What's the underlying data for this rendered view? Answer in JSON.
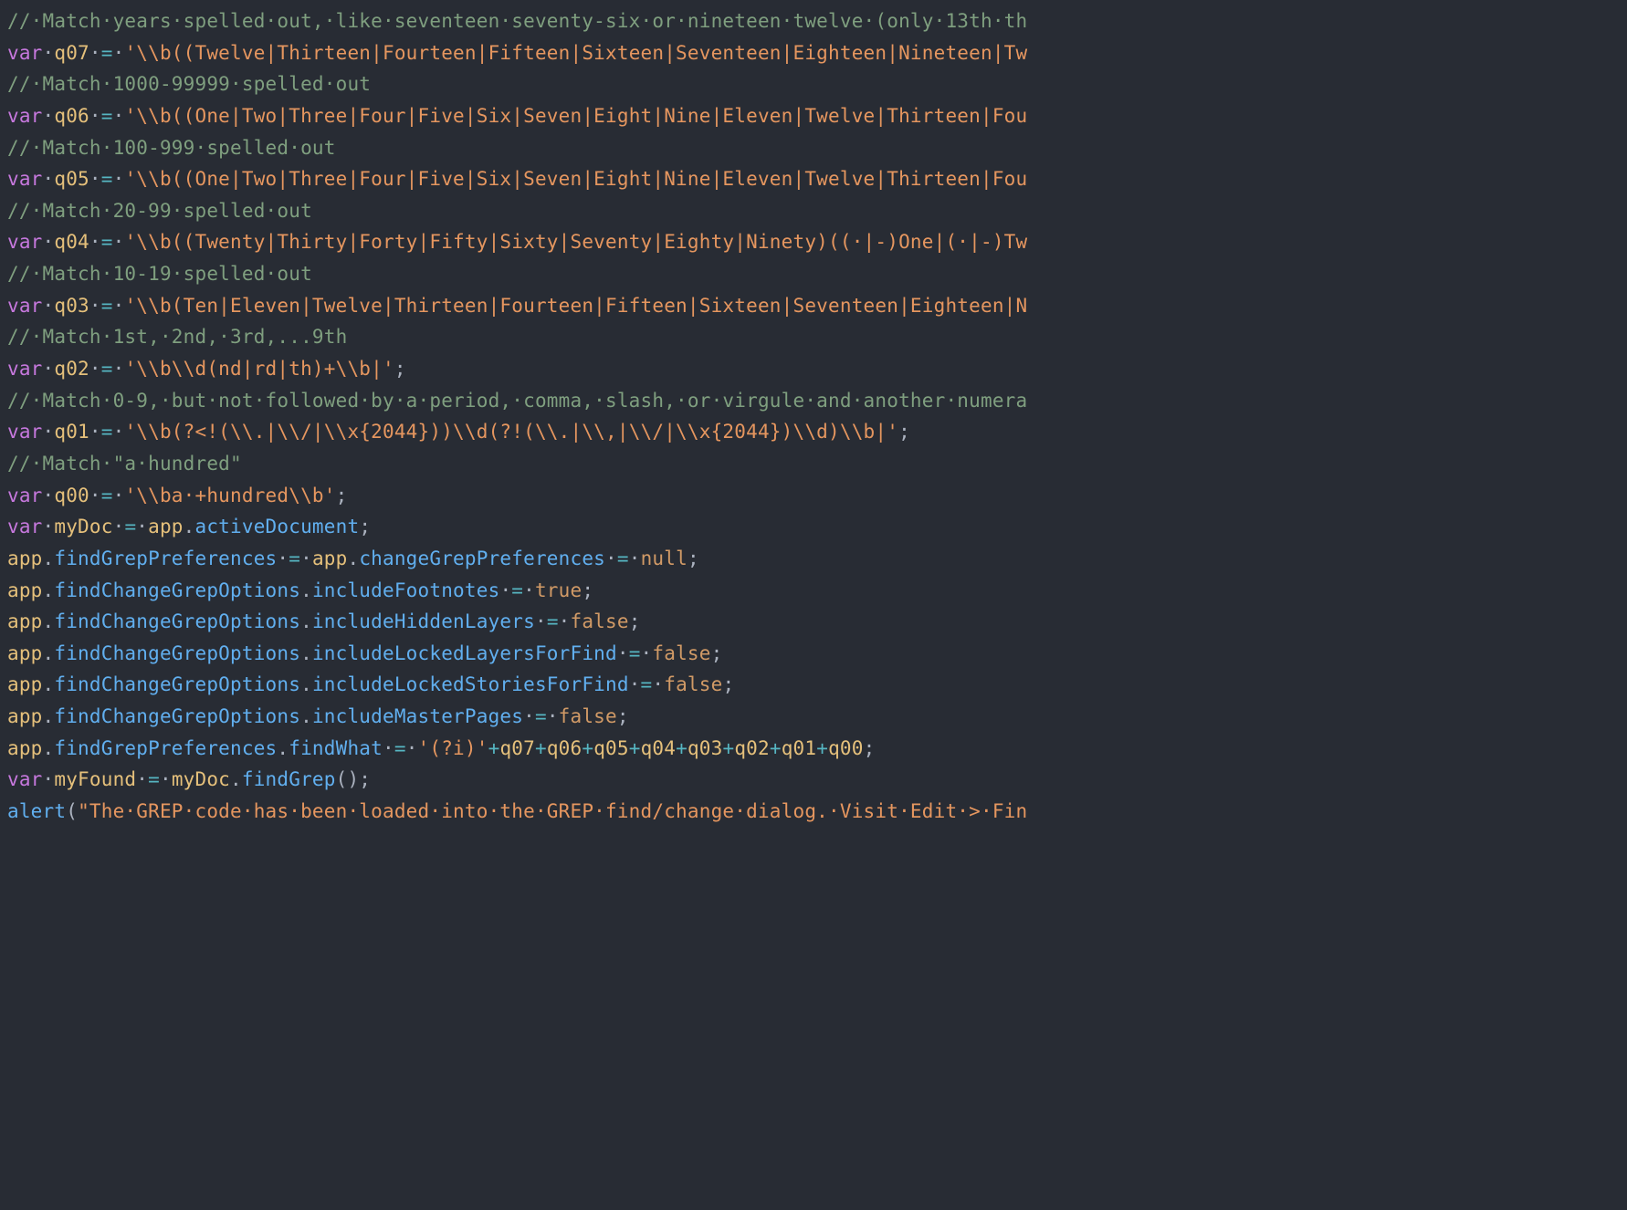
{
  "code": {
    "lines": [
      {
        "segments": [
          {
            "cls": "tok-comment",
            "text": "//·Match·years·spelled·out,·like·seventeen·seventy-six·or·nineteen·twelve·(only·13th·th"
          }
        ]
      },
      {
        "segments": [
          {
            "cls": "tok-keyword",
            "text": "var"
          },
          {
            "cls": "ws-dot",
            "text": "·"
          },
          {
            "cls": "tok-var",
            "text": "q07"
          },
          {
            "cls": "ws-dot",
            "text": "·"
          },
          {
            "cls": "tok-eq",
            "text": "="
          },
          {
            "cls": "ws-dot",
            "text": "·"
          },
          {
            "cls": "tok-string",
            "text": "'\\\\b((Twelve|Thirteen|Fourteen|Fifteen|Sixteen|Seventeen|Eighteen|Nineteen|Tw"
          }
        ]
      },
      {
        "segments": [
          {
            "cls": "tok-comment",
            "text": "//·Match·1000-99999·spelled·out"
          }
        ]
      },
      {
        "segments": [
          {
            "cls": "tok-keyword",
            "text": "var"
          },
          {
            "cls": "ws-dot",
            "text": "·"
          },
          {
            "cls": "tok-var",
            "text": "q06"
          },
          {
            "cls": "ws-dot",
            "text": "·"
          },
          {
            "cls": "tok-eq",
            "text": "="
          },
          {
            "cls": "ws-dot",
            "text": "·"
          },
          {
            "cls": "tok-string",
            "text": "'\\\\b((One|Two|Three|Four|Five|Six|Seven|Eight|Nine|Eleven|Twelve|Thirteen|Fou"
          }
        ]
      },
      {
        "segments": [
          {
            "cls": "tok-comment",
            "text": "//·Match·100-999·spelled·out"
          }
        ]
      },
      {
        "segments": [
          {
            "cls": "tok-keyword",
            "text": "var"
          },
          {
            "cls": "ws-dot",
            "text": "·"
          },
          {
            "cls": "tok-var",
            "text": "q05"
          },
          {
            "cls": "ws-dot",
            "text": "·"
          },
          {
            "cls": "tok-eq",
            "text": "="
          },
          {
            "cls": "ws-dot",
            "text": "·"
          },
          {
            "cls": "tok-string",
            "text": "'\\\\b((One|Two|Three|Four|Five|Six|Seven|Eight|Nine|Eleven|Twelve|Thirteen|Fou"
          }
        ]
      },
      {
        "segments": [
          {
            "cls": "tok-comment",
            "text": "//·Match·20-99·spelled·out"
          }
        ]
      },
      {
        "segments": [
          {
            "cls": "tok-keyword",
            "text": "var"
          },
          {
            "cls": "ws-dot",
            "text": "·"
          },
          {
            "cls": "tok-var",
            "text": "q04"
          },
          {
            "cls": "ws-dot",
            "text": "·"
          },
          {
            "cls": "tok-eq",
            "text": "="
          },
          {
            "cls": "ws-dot",
            "text": "·"
          },
          {
            "cls": "tok-string",
            "text": "'\\\\b((Twenty|Thirty|Forty|Fifty|Sixty|Seventy|Eighty|Ninety)((·|-)One|(·|-)Tw"
          }
        ]
      },
      {
        "segments": [
          {
            "cls": "tok-comment",
            "text": "//·Match·10-19·spelled·out"
          }
        ]
      },
      {
        "segments": [
          {
            "cls": "tok-keyword",
            "text": "var"
          },
          {
            "cls": "ws-dot",
            "text": "·"
          },
          {
            "cls": "tok-var",
            "text": "q03"
          },
          {
            "cls": "ws-dot",
            "text": "·"
          },
          {
            "cls": "tok-eq",
            "text": "="
          },
          {
            "cls": "ws-dot",
            "text": "·"
          },
          {
            "cls": "tok-string",
            "text": "'\\\\b(Ten|Eleven|Twelve|Thirteen|Fourteen|Fifteen|Sixteen|Seventeen|Eighteen|N"
          }
        ]
      },
      {
        "segments": [
          {
            "cls": "tok-comment",
            "text": "//·Match·1st,·2nd,·3rd,...9th"
          }
        ]
      },
      {
        "segments": [
          {
            "cls": "tok-keyword",
            "text": "var"
          },
          {
            "cls": "ws-dot",
            "text": "·"
          },
          {
            "cls": "tok-var",
            "text": "q02"
          },
          {
            "cls": "ws-dot",
            "text": "·"
          },
          {
            "cls": "tok-eq",
            "text": "="
          },
          {
            "cls": "ws-dot",
            "text": "·"
          },
          {
            "cls": "tok-string",
            "text": "'\\\\b\\\\d(nd|rd|th)+\\\\b|'"
          },
          {
            "cls": "tok-punct",
            "text": ";"
          }
        ]
      },
      {
        "segments": [
          {
            "cls": "tok-comment",
            "text": "//·Match·0-9,·but·not·followed·by·a·period,·comma,·slash,·or·virgule·and·another·numera"
          }
        ]
      },
      {
        "segments": [
          {
            "cls": "tok-keyword",
            "text": "var"
          },
          {
            "cls": "ws-dot",
            "text": "·"
          },
          {
            "cls": "tok-var",
            "text": "q01"
          },
          {
            "cls": "ws-dot",
            "text": "·"
          },
          {
            "cls": "tok-eq",
            "text": "="
          },
          {
            "cls": "ws-dot",
            "text": "·"
          },
          {
            "cls": "tok-string",
            "text": "'\\\\b(?<!(\\\\.|\\\\/|\\\\x{2044}))\\\\d(?!(\\\\.|\\\\,|\\\\/|\\\\x{2044})\\\\d)\\\\b|'"
          },
          {
            "cls": "tok-punct",
            "text": ";"
          }
        ]
      },
      {
        "segments": [
          {
            "cls": "tok-comment",
            "text": "//·Match·\"a·hundred\""
          }
        ]
      },
      {
        "segments": [
          {
            "cls": "tok-keyword",
            "text": "var"
          },
          {
            "cls": "ws-dot",
            "text": "·"
          },
          {
            "cls": "tok-var",
            "text": "q00"
          },
          {
            "cls": "ws-dot",
            "text": "·"
          },
          {
            "cls": "tok-eq",
            "text": "="
          },
          {
            "cls": "ws-dot",
            "text": "·"
          },
          {
            "cls": "tok-string",
            "text": "'\\\\ba·+hundred\\\\b'"
          },
          {
            "cls": "tok-punct",
            "text": ";"
          }
        ]
      },
      {
        "segments": [
          {
            "cls": "tok-keyword",
            "text": "var"
          },
          {
            "cls": "ws-dot",
            "text": "·"
          },
          {
            "cls": "tok-var",
            "text": "myDoc"
          },
          {
            "cls": "ws-dot",
            "text": "·"
          },
          {
            "cls": "tok-eq",
            "text": "="
          },
          {
            "cls": "ws-dot",
            "text": "·"
          },
          {
            "cls": "tok-var",
            "text": "app"
          },
          {
            "cls": "tok-punct",
            "text": "."
          },
          {
            "cls": "tok-prop",
            "text": "activeDocument"
          },
          {
            "cls": "tok-punct",
            "text": ";"
          }
        ]
      },
      {
        "segments": [
          {
            "cls": "tok-var",
            "text": "app"
          },
          {
            "cls": "tok-punct",
            "text": "."
          },
          {
            "cls": "tok-prop",
            "text": "findGrepPreferences"
          },
          {
            "cls": "ws-dot",
            "text": "·"
          },
          {
            "cls": "tok-eq",
            "text": "="
          },
          {
            "cls": "ws-dot",
            "text": "·"
          },
          {
            "cls": "tok-var",
            "text": "app"
          },
          {
            "cls": "tok-punct",
            "text": "."
          },
          {
            "cls": "tok-prop",
            "text": "changeGrepPreferences"
          },
          {
            "cls": "ws-dot",
            "text": "·"
          },
          {
            "cls": "tok-eq",
            "text": "="
          },
          {
            "cls": "ws-dot",
            "text": "·"
          },
          {
            "cls": "tok-null",
            "text": "null"
          },
          {
            "cls": "tok-punct",
            "text": ";"
          }
        ]
      },
      {
        "segments": [
          {
            "cls": "tok-var",
            "text": "app"
          },
          {
            "cls": "tok-punct",
            "text": "."
          },
          {
            "cls": "tok-prop",
            "text": "findChangeGrepOptions"
          },
          {
            "cls": "tok-punct",
            "text": "."
          },
          {
            "cls": "tok-prop",
            "text": "includeFootnotes"
          },
          {
            "cls": "ws-dot",
            "text": "·"
          },
          {
            "cls": "tok-eq",
            "text": "="
          },
          {
            "cls": "ws-dot",
            "text": "·"
          },
          {
            "cls": "tok-bool",
            "text": "true"
          },
          {
            "cls": "tok-punct",
            "text": ";"
          }
        ]
      },
      {
        "segments": [
          {
            "cls": "tok-var",
            "text": "app"
          },
          {
            "cls": "tok-punct",
            "text": "."
          },
          {
            "cls": "tok-prop",
            "text": "findChangeGrepOptions"
          },
          {
            "cls": "tok-punct",
            "text": "."
          },
          {
            "cls": "tok-prop",
            "text": "includeHiddenLayers"
          },
          {
            "cls": "ws-dot",
            "text": "·"
          },
          {
            "cls": "tok-eq",
            "text": "="
          },
          {
            "cls": "ws-dot",
            "text": "·"
          },
          {
            "cls": "tok-bool",
            "text": "false"
          },
          {
            "cls": "tok-punct",
            "text": ";"
          }
        ]
      },
      {
        "segments": [
          {
            "cls": "tok-var",
            "text": "app"
          },
          {
            "cls": "tok-punct",
            "text": "."
          },
          {
            "cls": "tok-prop",
            "text": "findChangeGrepOptions"
          },
          {
            "cls": "tok-punct",
            "text": "."
          },
          {
            "cls": "tok-prop",
            "text": "includeLockedLayersForFind"
          },
          {
            "cls": "ws-dot",
            "text": "·"
          },
          {
            "cls": "tok-eq",
            "text": "="
          },
          {
            "cls": "ws-dot",
            "text": "·"
          },
          {
            "cls": "tok-bool",
            "text": "false"
          },
          {
            "cls": "tok-punct",
            "text": ";"
          }
        ]
      },
      {
        "segments": [
          {
            "cls": "tok-var",
            "text": "app"
          },
          {
            "cls": "tok-punct",
            "text": "."
          },
          {
            "cls": "tok-prop",
            "text": "findChangeGrepOptions"
          },
          {
            "cls": "tok-punct",
            "text": "."
          },
          {
            "cls": "tok-prop",
            "text": "includeLockedStoriesForFind"
          },
          {
            "cls": "ws-dot",
            "text": "·"
          },
          {
            "cls": "tok-eq",
            "text": "="
          },
          {
            "cls": "ws-dot",
            "text": "·"
          },
          {
            "cls": "tok-bool",
            "text": "false"
          },
          {
            "cls": "tok-punct",
            "text": ";"
          }
        ]
      },
      {
        "segments": [
          {
            "cls": "tok-var",
            "text": "app"
          },
          {
            "cls": "tok-punct",
            "text": "."
          },
          {
            "cls": "tok-prop",
            "text": "findChangeGrepOptions"
          },
          {
            "cls": "tok-punct",
            "text": "."
          },
          {
            "cls": "tok-prop",
            "text": "includeMasterPages"
          },
          {
            "cls": "ws-dot",
            "text": "·"
          },
          {
            "cls": "tok-eq",
            "text": "="
          },
          {
            "cls": "ws-dot",
            "text": "·"
          },
          {
            "cls": "tok-bool",
            "text": "false"
          },
          {
            "cls": "tok-punct",
            "text": ";"
          }
        ]
      },
      {
        "segments": [
          {
            "cls": "tok-var",
            "text": "app"
          },
          {
            "cls": "tok-punct",
            "text": "."
          },
          {
            "cls": "tok-prop",
            "text": "findGrepPreferences"
          },
          {
            "cls": "tok-punct",
            "text": "."
          },
          {
            "cls": "tok-prop",
            "text": "findWhat"
          },
          {
            "cls": "ws-dot",
            "text": "·"
          },
          {
            "cls": "tok-eq",
            "text": "="
          },
          {
            "cls": "ws-dot",
            "text": "·"
          },
          {
            "cls": "tok-string",
            "text": "'(?i)'"
          },
          {
            "cls": "tok-plus",
            "text": "+"
          },
          {
            "cls": "tok-var",
            "text": "q07"
          },
          {
            "cls": "tok-plus",
            "text": "+"
          },
          {
            "cls": "tok-var",
            "text": "q06"
          },
          {
            "cls": "tok-plus",
            "text": "+"
          },
          {
            "cls": "tok-var",
            "text": "q05"
          },
          {
            "cls": "tok-plus",
            "text": "+"
          },
          {
            "cls": "tok-var",
            "text": "q04"
          },
          {
            "cls": "tok-plus",
            "text": "+"
          },
          {
            "cls": "tok-var",
            "text": "q03"
          },
          {
            "cls": "tok-plus",
            "text": "+"
          },
          {
            "cls": "tok-var",
            "text": "q02"
          },
          {
            "cls": "tok-plus",
            "text": "+"
          },
          {
            "cls": "tok-var",
            "text": "q01"
          },
          {
            "cls": "tok-plus",
            "text": "+"
          },
          {
            "cls": "tok-var",
            "text": "q00"
          },
          {
            "cls": "tok-punct",
            "text": ";"
          }
        ]
      },
      {
        "segments": [
          {
            "cls": "tok-keyword",
            "text": "var"
          },
          {
            "cls": "ws-dot",
            "text": "·"
          },
          {
            "cls": "tok-var",
            "text": "myFound"
          },
          {
            "cls": "ws-dot",
            "text": "·"
          },
          {
            "cls": "tok-eq",
            "text": "="
          },
          {
            "cls": "ws-dot",
            "text": "·"
          },
          {
            "cls": "tok-var",
            "text": "myDoc"
          },
          {
            "cls": "tok-punct",
            "text": "."
          },
          {
            "cls": "tok-func",
            "text": "findGrep"
          },
          {
            "cls": "tok-punct",
            "text": "();"
          }
        ]
      },
      {
        "segments": [
          {
            "cls": "tok-func",
            "text": "alert"
          },
          {
            "cls": "tok-punct",
            "text": "("
          },
          {
            "cls": "tok-string",
            "text": "\"The·GREP·code·has·been·loaded·into·the·GREP·find/change·dialog.·Visit·Edit·>·Fin"
          }
        ]
      }
    ]
  }
}
